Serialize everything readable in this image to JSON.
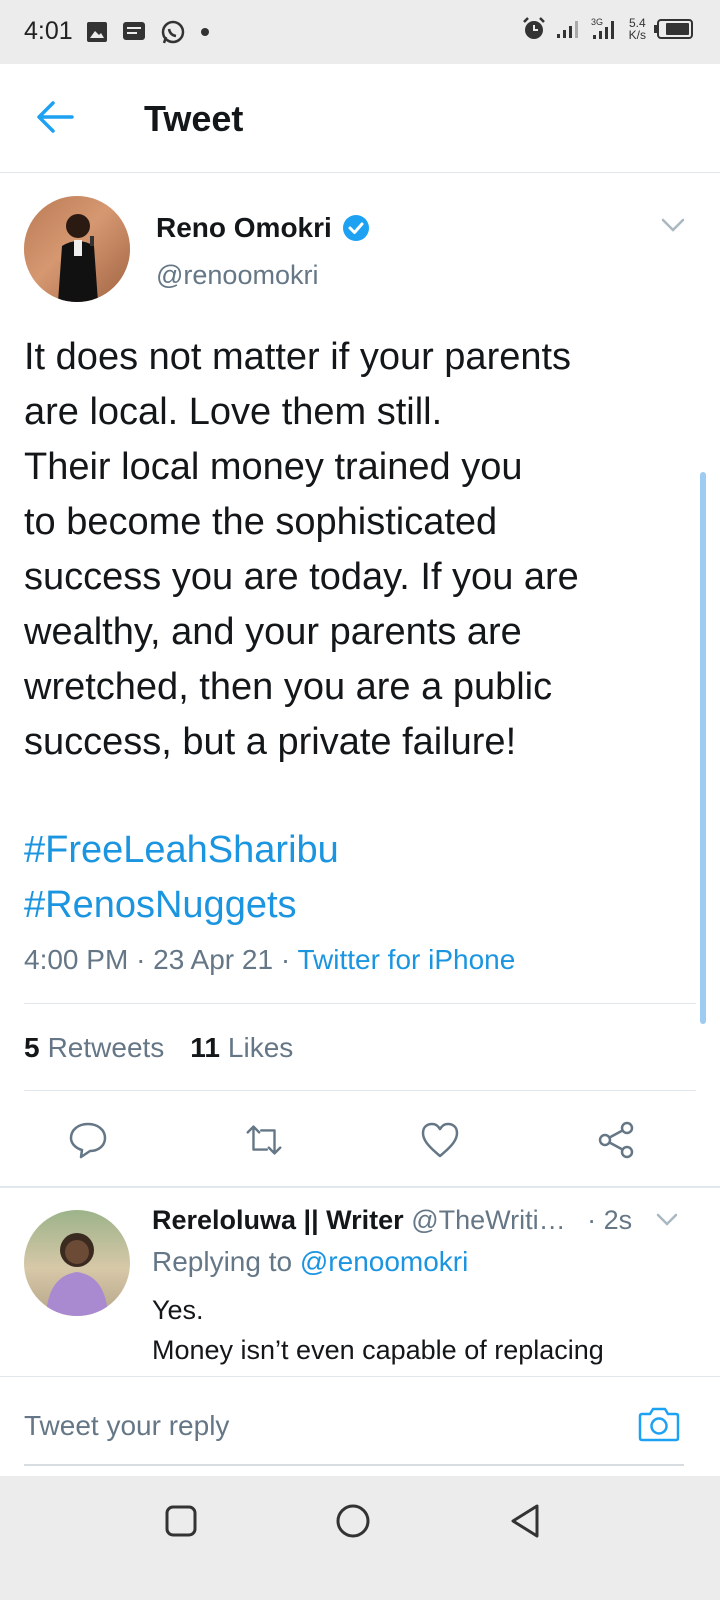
{
  "status_bar": {
    "time": "4:01",
    "net_speed": "5.4",
    "net_unit": "K/s",
    "network_type": "3G",
    "icons": [
      "image-icon",
      "message-icon",
      "whatsapp-icon",
      "dot-icon",
      "alarm-icon",
      "signal-icon",
      "signal-3g-icon",
      "battery-icon"
    ]
  },
  "header": {
    "title": "Tweet"
  },
  "tweet": {
    "author_name": "Reno Omokri",
    "author_handle": "@renoomokri",
    "verified": true,
    "text": "It does not matter if your parents\nare local. Love them still.\nTheir local money trained you\nto become the sophisticated\nsuccess you are today. If you are\nwealthy, and your parents are\nwretched, then you are a public\nsuccess, but a private failure!",
    "hashtags": [
      "#FreeLeahSharibu",
      "#RenosNuggets"
    ],
    "time": "4:00 PM",
    "date": "23 Apr 21",
    "source": "Twitter for iPhone",
    "retweets_count": "5",
    "retweets_label": "Retweets",
    "likes_count": "11",
    "likes_label": "Likes"
  },
  "reply": {
    "name": "Rereloluwa || Writer",
    "handle": "@TheWriti…",
    "time": "· 2s",
    "replying_label": "Replying to",
    "replying_handle": "@renoomokri",
    "text": "Yes.\nMoney isn’t even capable of replacing"
  },
  "composer": {
    "placeholder": "Tweet your reply"
  },
  "colors": {
    "accent": "#1da1f2",
    "link": "#1b95e0",
    "text": "#14171a",
    "muted": "#657786"
  }
}
